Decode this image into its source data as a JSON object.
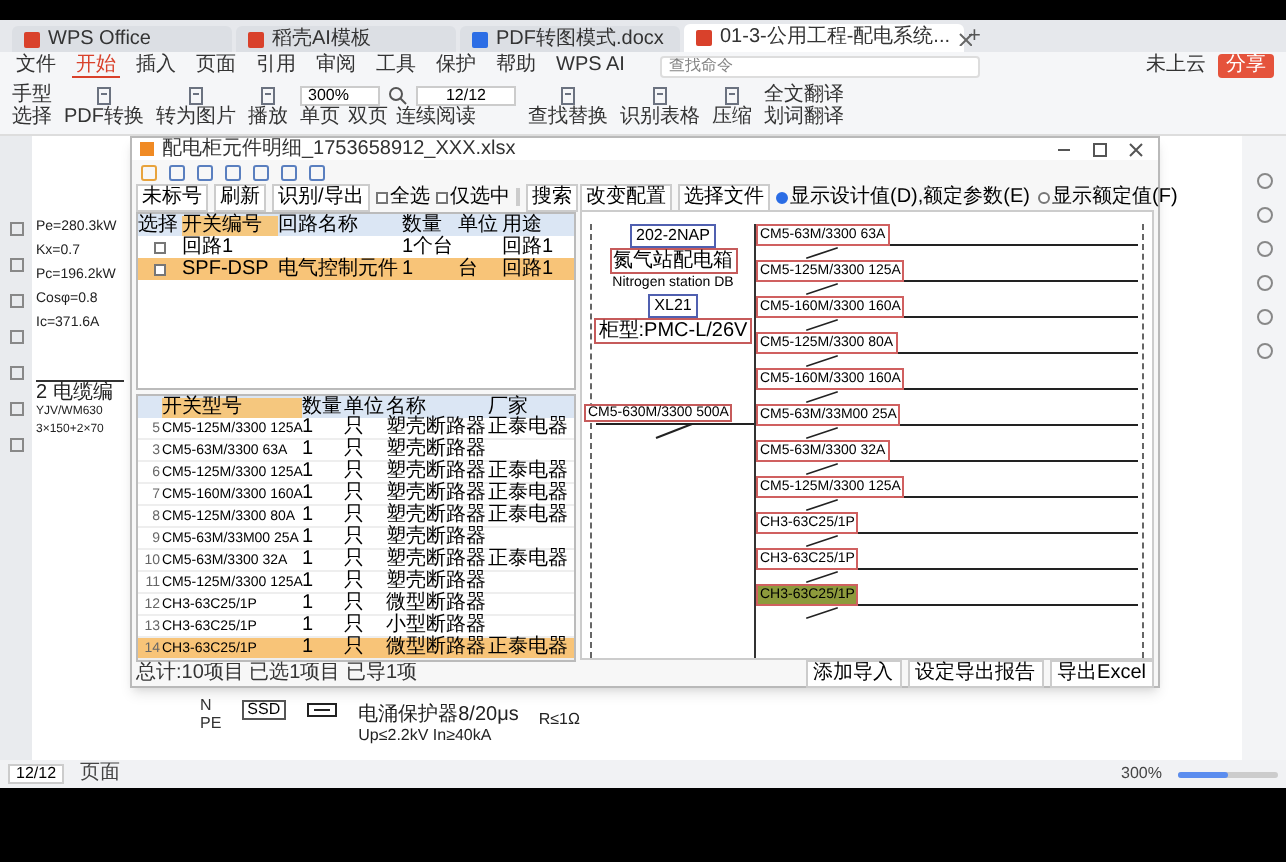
{
  "tabs": [
    {
      "label": "WPS Office",
      "selected": false
    },
    {
      "label": "稻壳AI模板",
      "selected": false
    },
    {
      "label": "PDF转图模式.docx",
      "selected": false
    },
    {
      "label": "01-3-公用工程-配电系统...",
      "selected": true
    }
  ],
  "new_tab": "+",
  "menu": [
    {
      "label": "文件",
      "selected": false
    },
    {
      "label": "开始",
      "selected": true
    },
    {
      "label": "插入",
      "selected": false
    },
    {
      "label": "页面",
      "selected": false
    },
    {
      "label": "引用",
      "selected": false
    },
    {
      "label": "审阅",
      "selected": false
    },
    {
      "label": "工具",
      "selected": false
    },
    {
      "label": "保护",
      "selected": false
    },
    {
      "label": "帮助",
      "selected": false
    },
    {
      "label": "WPS AI",
      "selected": false
    }
  ],
  "search": {
    "placeholder": "查找命令"
  },
  "header_actions": [
    {
      "label": "未上云",
      "kind": "plain"
    },
    {
      "label": "分享",
      "kind": "primary"
    }
  ],
  "ribbon": {
    "pointer_tools": [
      "手型",
      "选择"
    ],
    "large_tools": [
      "PDF转换",
      "转为图片",
      "播放"
    ],
    "zoom": "300%",
    "page": "12/12",
    "view_tools": [
      "单页",
      "双页",
      "连续阅读"
    ],
    "right_tools": [
      "查找替换",
      "识别表格",
      "压缩"
    ],
    "translate_tools": [
      "全文翻译",
      "划词翻译"
    ]
  },
  "document": {
    "calc": [
      "Pe=280.3kW",
      "Kx=0.7",
      "Pc=196.2kW",
      "Cosφ=0.8",
      "Ic=371.6A"
    ],
    "cable": [
      "2 电缆编",
      "YJV/WM630",
      "3×150+2×70"
    ],
    "bottom": {
      "bus_labels": [
        "N",
        "PE"
      ],
      "device": "SSD",
      "spd": "电涌保护器8/20μs",
      "spd_rating": "Up≤2.2kV In≥40kA",
      "ground": "R≤1Ω"
    }
  },
  "dialog": {
    "title": "配电柜元件明细_1753658912_XXX.xlsx",
    "buttons": [
      "未标号",
      "刷新",
      "识别/导出"
    ],
    "options": [
      {
        "label": "全选",
        "checked": false
      },
      {
        "label": "仅选中",
        "checked": false
      }
    ],
    "search_button": "搜索",
    "upper_table": {
      "columns": [
        "选择",
        "开关编号",
        "回路名称",
        "数量",
        "单位",
        "用途"
      ],
      "rows": [
        {
          "checked": false,
          "selected": false,
          "cells": [
            "",
            "回路1",
            "",
            "1个台",
            "",
            "回路1"
          ]
        },
        {
          "checked": false,
          "selected": true,
          "cells": [
            "",
            "SPF-DSP",
            "电气控制元件",
            "1",
            "台",
            "回路1"
          ]
        }
      ]
    },
    "lower_table": {
      "columns": [
        "开关型号",
        "数量",
        "单位",
        "名称",
        "厂家"
      ],
      "rows": [
        {
          "number": "5",
          "selected": false,
          "cells": [
            "CM5-125M/3300 125A",
            "1",
            "只",
            "塑壳断路器",
            "正泰电器"
          ]
        },
        {
          "number": "3",
          "selected": false,
          "cells": [
            "CM5-63M/3300 63A",
            "1",
            "只",
            "塑壳断路器",
            ""
          ]
        },
        {
          "number": "6",
          "selected": false,
          "cells": [
            "CM5-125M/3300 125A",
            "1",
            "只",
            "塑壳断路器",
            "正泰电器"
          ]
        },
        {
          "number": "7",
          "selected": false,
          "cells": [
            "CM5-160M/3300 160A",
            "1",
            "只",
            "塑壳断路器",
            "正泰电器"
          ]
        },
        {
          "number": "8",
          "selected": false,
          "cells": [
            "CM5-125M/3300 80A",
            "1",
            "只",
            "塑壳断路器",
            "正泰电器"
          ]
        },
        {
          "number": "9",
          "selected": false,
          "cells": [
            "CM5-63M/33M00 25A",
            "1",
            "只",
            "塑壳断路器",
            ""
          ]
        },
        {
          "number": "10",
          "selected": false,
          "cells": [
            "CM5-63M/3300 32A",
            "1",
            "只",
            "塑壳断路器",
            "正泰电器"
          ]
        },
        {
          "number": "11",
          "selected": false,
          "cells": [
            "CM5-125M/3300 125A",
            "1",
            "只",
            "塑壳断路器",
            ""
          ]
        },
        {
          "number": "12",
          "selected": false,
          "cells": [
            "CH3-63C25/1P",
            "1",
            "只",
            "微型断路器",
            ""
          ]
        },
        {
          "number": "13",
          "selected": false,
          "cells": [
            "CH3-63C25/1P",
            "1",
            "只",
            "小型断路器",
            ""
          ]
        },
        {
          "number": "14",
          "selected": true,
          "cells": [
            "CH3-63C25/1P",
            "1",
            "只",
            "微型断路器",
            "正泰电器"
          ]
        }
      ]
    },
    "summary": "总计:10项目 已选1项目 已导1项",
    "right_buttons": [
      "改变配置",
      "选择文件"
    ],
    "radios": [
      {
        "label": "显示设计值(D),额定参数(E)",
        "selected": true
      },
      {
        "label": "显示额定值(F)",
        "selected": false
      }
    ],
    "diagram": {
      "header": [
        "202-2NAP",
        "氮气站配电箱",
        "Nitrogen station DB",
        "XL21",
        "柜型:PMC-L/26V"
      ],
      "incoming": "CM5-630M/3300 500A",
      "breakers": [
        {
          "label": "CM5-63M/3300 63A",
          "highlighted": false
        },
        {
          "label": "CM5-125M/3300 125A",
          "highlighted": false
        },
        {
          "label": "CM5-160M/3300 160A",
          "highlighted": false
        },
        {
          "label": "CM5-125M/3300 80A",
          "highlighted": false
        },
        {
          "label": "CM5-160M/3300 160A",
          "highlighted": false
        },
        {
          "label": "CM5-63M/33M00 25A",
          "highlighted": false
        },
        {
          "label": "CM5-63M/3300 32A",
          "highlighted": false
        },
        {
          "label": "CM5-125M/3300 125A",
          "highlighted": false
        },
        {
          "label": "CH3-63C25/1P",
          "highlighted": false
        },
        {
          "label": "CH3-63C25/1P",
          "highlighted": false
        },
        {
          "label": "CH3-63C25/1P",
          "highlighted": true
        }
      ]
    },
    "footer_buttons": [
      "添加导入",
      "设定导出报告",
      "导出Excel"
    ]
  },
  "status_bar": {
    "page": "12/12",
    "view": "页面",
    "zoom": "300%",
    "zoom_slider": {
      "level": 0.5
    }
  }
}
